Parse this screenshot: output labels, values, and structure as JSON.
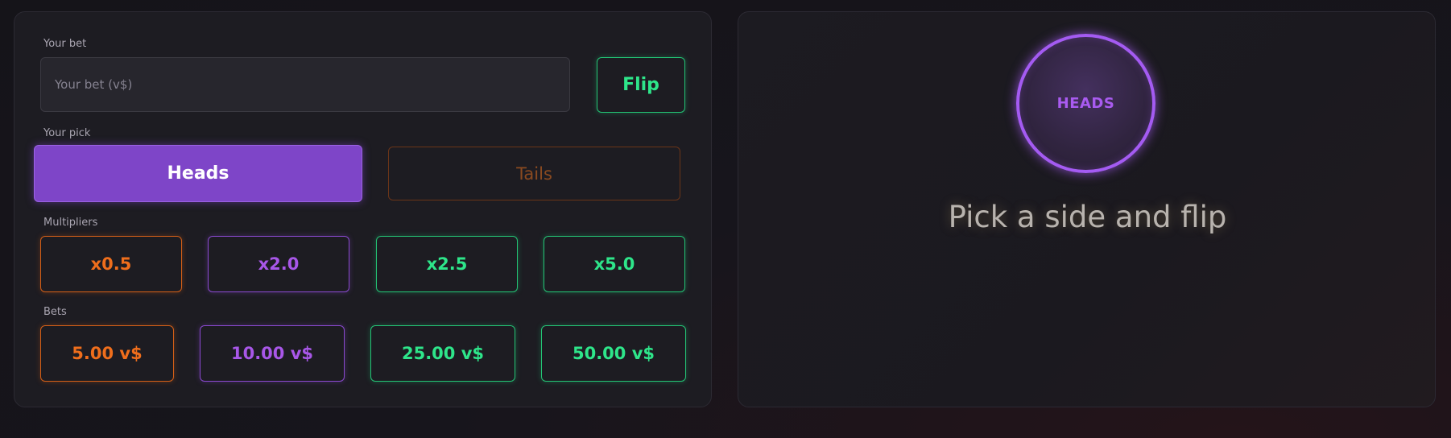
{
  "bet": {
    "label": "Your bet",
    "placeholder": "Your bet (v$)",
    "value": "",
    "flip_label": "Flip"
  },
  "pick": {
    "label": "Your pick",
    "heads_label": "Heads",
    "tails_label": "Tails",
    "selected": "Heads"
  },
  "multipliers": {
    "label": "Multipliers",
    "items": [
      "x0.5",
      "x2.0",
      "x2.5",
      "x5.0"
    ]
  },
  "bets": {
    "label": "Bets",
    "items": [
      "5.00 v$",
      "10.00 v$",
      "25.00 v$",
      "50.00 v$"
    ]
  },
  "coin": {
    "face": "HEADS",
    "status": "Pick a side and flip"
  },
  "colors": {
    "green": "#2ee58a",
    "orange": "#ef6e1c",
    "purple": "#a857e8",
    "selected_fill": "#7e45c8"
  }
}
